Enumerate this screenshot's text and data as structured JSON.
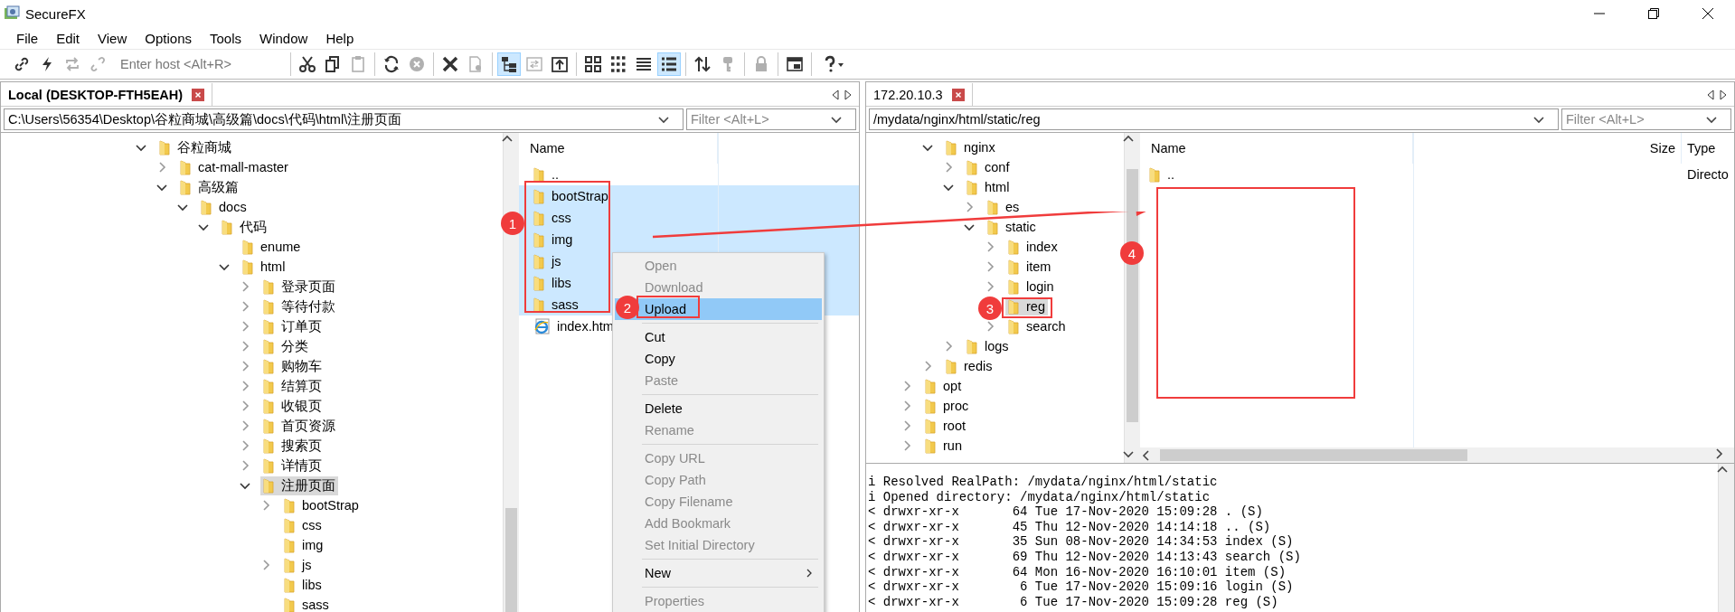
{
  "window": {
    "title": "SecureFX"
  },
  "menu": [
    "File",
    "Edit",
    "View",
    "Options",
    "Tools",
    "Window",
    "Help"
  ],
  "toolbar": {
    "host_field": {
      "placeholder": "Enter host <Alt+R>"
    },
    "groups": [
      [
        {
          "selected": false,
          "disabled": false
        },
        {
          "selected": false,
          "disabled": false
        },
        {
          "selected": false,
          "disabled": true
        },
        {
          "selected": false,
          "disabled": true
        }
      ],
      [
        {
          "selected": false,
          "disabled": false
        },
        {
          "selected": false,
          "disabled": false
        },
        {
          "selected": false,
          "disabled": true
        }
      ],
      [
        {
          "selected": false,
          "disabled": false
        },
        {
          "selected": false,
          "disabled": true
        }
      ],
      [
        {
          "selected": false,
          "disabled": false
        },
        {
          "selected": false,
          "disabled": true
        }
      ],
      [
        {
          "selected": true,
          "disabled": false
        },
        {
          "selected": false,
          "disabled": true
        },
        {
          "selected": false,
          "disabled": false
        }
      ],
      [
        {
          "selected": false,
          "disabled": false
        },
        {
          "selected": false,
          "disabled": false
        },
        {
          "selected": false,
          "disabled": false
        },
        {
          "selected": true,
          "disabled": false
        }
      ],
      [
        {
          "selected": false,
          "disabled": false
        },
        {
          "selected": false,
          "disabled": true
        }
      ],
      [
        {
          "selected": false,
          "disabled": true
        }
      ],
      [
        {
          "selected": false,
          "disabled": false
        }
      ],
      [
        {
          "selected": false,
          "disabled": false
        }
      ]
    ]
  },
  "local": {
    "tab": {
      "label": "Local (DESKTOP-FTH5EAH)",
      "active": true
    },
    "path": "C:\\Users\\56354\\Desktop\\谷粒商城\\高级篇\\docs\\代码\\html\\注册页面",
    "filter": {
      "placeholder": "Filter <Alt+L>"
    },
    "tree": [
      {
        "name": "谷粒商城",
        "kind": "branch",
        "expanded": true,
        "selected": false,
        "children": [
          {
            "name": "cat-mall-master",
            "kind": "branch",
            "expanded": false,
            "selected": false
          },
          {
            "name": "高级篇",
            "kind": "branch",
            "expanded": true,
            "selected": false,
            "children": [
              {
                "name": "docs",
                "kind": "branch",
                "expanded": true,
                "selected": false,
                "children": [
                  {
                    "name": "代码",
                    "kind": "branch",
                    "expanded": true,
                    "selected": false,
                    "children": [
                      {
                        "name": "enume",
                        "kind": "leaf",
                        "selected": false
                      },
                      {
                        "name": "html",
                        "kind": "branch",
                        "expanded": true,
                        "selected": false,
                        "children": [
                          {
                            "name": "登录页面",
                            "kind": "branch",
                            "expanded": false,
                            "selected": false
                          },
                          {
                            "name": "等待付款",
                            "kind": "branch",
                            "expanded": false,
                            "selected": false
                          },
                          {
                            "name": "订单页",
                            "kind": "branch",
                            "expanded": false,
                            "selected": false
                          },
                          {
                            "name": "分类",
                            "kind": "branch",
                            "expanded": false,
                            "selected": false
                          },
                          {
                            "name": "购物车",
                            "kind": "branch",
                            "expanded": false,
                            "selected": false
                          },
                          {
                            "name": "结算页",
                            "kind": "branch",
                            "expanded": false,
                            "selected": false
                          },
                          {
                            "name": "收银页",
                            "kind": "branch",
                            "expanded": false,
                            "selected": false
                          },
                          {
                            "name": "首页资源",
                            "kind": "branch",
                            "expanded": false,
                            "selected": false
                          },
                          {
                            "name": "搜索页",
                            "kind": "branch",
                            "expanded": false,
                            "selected": false
                          },
                          {
                            "name": "详情页",
                            "kind": "branch",
                            "expanded": false,
                            "selected": false
                          },
                          {
                            "name": "注册页面",
                            "kind": "branch",
                            "expanded": true,
                            "selected": true,
                            "children": [
                              {
                                "name": "bootStrap",
                                "kind": "branch",
                                "expanded": false,
                                "selected": false
                              },
                              {
                                "name": "css",
                                "kind": "leaf",
                                "selected": false
                              },
                              {
                                "name": "img",
                                "kind": "leaf",
                                "selected": false
                              },
                              {
                                "name": "js",
                                "kind": "branch",
                                "expanded": false,
                                "selected": false
                              },
                              {
                                "name": "libs",
                                "kind": "leaf",
                                "selected": false
                              },
                              {
                                "name": "sass",
                                "kind": "leaf",
                                "selected": false
                              }
                            ]
                          }
                        ]
                      }
                    ]
                  }
                ]
              }
            ]
          }
        ]
      }
    ],
    "files": {
      "columns": [
        "Name"
      ],
      "rows": [
        {
          "name": "..",
          "kind": "folder",
          "selected": false
        },
        {
          "name": "bootStrap",
          "kind": "folder",
          "selected": true
        },
        {
          "name": "css",
          "kind": "folder",
          "selected": true
        },
        {
          "name": "img",
          "kind": "folder",
          "selected": true
        },
        {
          "name": "js",
          "kind": "folder",
          "selected": true
        },
        {
          "name": "libs",
          "kind": "folder",
          "selected": true
        },
        {
          "name": "sass",
          "kind": "folder",
          "selected": true
        },
        {
          "name": "index.htm",
          "kind": "html",
          "selected": false
        }
      ]
    }
  },
  "remote": {
    "tab": {
      "label": "172.20.10.3",
      "active": false
    },
    "path": "/mydata/nginx/html/static/reg",
    "filter": {
      "placeholder": "Filter <Alt+L>"
    },
    "tree": [
      {
        "children": [
          {
            "name": "nginx",
            "kind": "branch",
            "expanded": true,
            "selected": false,
            "children": [
              {
                "name": "conf",
                "kind": "branch",
                "expanded": false,
                "selected": false
              },
              {
                "name": "html",
                "kind": "branch",
                "expanded": true,
                "selected": false,
                "children": [
                  {
                    "name": "es",
                    "kind": "branch",
                    "expanded": false,
                    "selected": false
                  },
                  {
                    "name": "static",
                    "kind": "branch",
                    "expanded": true,
                    "selected": false,
                    "children": [
                      {
                        "name": "index",
                        "kind": "branch",
                        "expanded": false,
                        "selected": false
                      },
                      {
                        "name": "item",
                        "kind": "branch",
                        "expanded": false,
                        "selected": false
                      },
                      {
                        "name": "login",
                        "kind": "branch",
                        "expanded": false,
                        "selected": false
                      },
                      {
                        "name": "reg",
                        "kind": "leaf",
                        "selected": true
                      },
                      {
                        "name": "search",
                        "kind": "branch",
                        "expanded": false,
                        "selected": false
                      }
                    ]
                  }
                ]
              },
              {
                "name": "logs",
                "kind": "branch",
                "expanded": false,
                "selected": false
              }
            ]
          },
          {
            "name": "redis",
            "kind": "branch",
            "expanded": false,
            "selected": false
          }
        ]
      },
      {
        "name": "opt",
        "kind": "branch",
        "expanded": false,
        "selected": false
      },
      {
        "name": "proc",
        "kind": "branch",
        "expanded": false,
        "selected": false
      },
      {
        "name": "root",
        "kind": "branch",
        "expanded": false,
        "selected": false
      },
      {
        "name": "run",
        "kind": "branch",
        "expanded": false,
        "selected": false
      }
    ],
    "files": {
      "columns": [
        "Name",
        "Size",
        "Type"
      ],
      "rows": [
        {
          "name": "..",
          "kind": "folder",
          "type": "Directo",
          "selected": false
        }
      ]
    }
  },
  "log": [
    "i Resolved RealPath: /mydata/nginx/html/static",
    "i Opened directory: /mydata/nginx/html/static",
    "< drwxr-xr-x       64 Tue 17-Nov-2020 15:09:28 . (S)",
    "< drwxr-xr-x       45 Thu 12-Nov-2020 14:14:18 .. (S)",
    "< drwxr-xr-x       35 Sun 08-Nov-2020 14:34:53 index (S)",
    "< drwxr-xr-x       69 Thu 12-Nov-2020 14:13:43 search (S)",
    "< drwxr-xr-x       64 Mon 16-Nov-2020 16:10:01 item (S)",
    "< drwxr-xr-x        6 Tue 17-Nov-2020 15:09:16 login (S)",
    "< drwxr-xr-x        6 Tue 17-Nov-2020 15:09:28 reg (S)"
  ],
  "context_menu": [
    {
      "kind": "item",
      "label": "Open",
      "disabled": true,
      "selected": false
    },
    {
      "kind": "item",
      "label": "Download",
      "disabled": true,
      "selected": false
    },
    {
      "kind": "item",
      "label": "Upload",
      "disabled": false,
      "selected": true
    },
    {
      "kind": "separator"
    },
    {
      "kind": "item",
      "label": "Cut",
      "disabled": false,
      "selected": false
    },
    {
      "kind": "item",
      "label": "Copy",
      "disabled": false,
      "selected": false
    },
    {
      "kind": "item",
      "label": "Paste",
      "disabled": true,
      "selected": false
    },
    {
      "kind": "separator"
    },
    {
      "kind": "item",
      "label": "Delete",
      "disabled": false,
      "selected": false
    },
    {
      "kind": "item",
      "label": "Rename",
      "disabled": true,
      "selected": false
    },
    {
      "kind": "separator"
    },
    {
      "kind": "item",
      "label": "Copy URL",
      "disabled": true,
      "selected": false
    },
    {
      "kind": "item",
      "label": "Copy Path",
      "disabled": true,
      "selected": false
    },
    {
      "kind": "item",
      "label": "Copy Filename",
      "disabled": true,
      "selected": false
    },
    {
      "kind": "item",
      "label": "Add Bookmark",
      "disabled": true,
      "selected": false
    },
    {
      "kind": "item",
      "label": "Set Initial Directory",
      "disabled": true,
      "selected": false
    },
    {
      "kind": "separator"
    },
    {
      "kind": "item",
      "label": "New",
      "disabled": false,
      "selected": false,
      "submenu": true
    },
    {
      "kind": "separator"
    },
    {
      "kind": "item",
      "label": "Properties",
      "disabled": true,
      "selected": false
    }
  ],
  "annotations": [
    {
      "label": "1"
    },
    {
      "label": "2"
    },
    {
      "label": "3"
    },
    {
      "label": "4"
    }
  ]
}
